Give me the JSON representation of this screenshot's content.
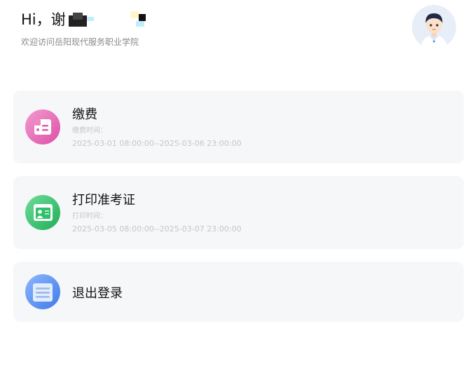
{
  "header": {
    "greeting": "Hi，谢",
    "school": "欢迎访问岳阳现代服务职业学院"
  },
  "cards": [
    {
      "title": "缴费",
      "time_label": "缴费时间：",
      "time_range": "2025-03-01 08:00:00--2025-03-06 23:00:00",
      "icon": "payment-card-icon",
      "color": "#e35fae"
    },
    {
      "title": "打印准考证",
      "time_label": "打印时间：",
      "time_range": "2025-03-05 08:00:00--2025-03-07 23:00:00",
      "icon": "id-card-icon",
      "color": "#2ec06a"
    },
    {
      "title": "退出登录",
      "icon": "document-list-icon",
      "color": "#5a8ff0"
    }
  ]
}
